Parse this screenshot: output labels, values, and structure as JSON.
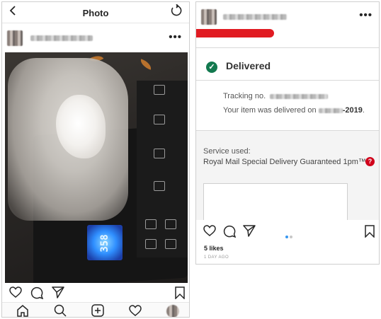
{
  "left_post": {
    "header": {
      "title": "Photo",
      "back_icon": "chevron-left-icon",
      "refresh_icon": "refresh-icon"
    },
    "user": {
      "avatar": "blurred-avatar",
      "username_blurred": true,
      "more_label": "•••"
    },
    "photo": {
      "scale_display": "358"
    },
    "actions": {
      "like_icon": "heart-icon",
      "comment_icon": "comment-icon",
      "share_icon": "send-icon",
      "save_icon": "bookmark-icon"
    },
    "bottom_nav": [
      {
        "icon": "home-icon"
      },
      {
        "icon": "search-icon"
      },
      {
        "icon": "add-post-icon"
      },
      {
        "icon": "activity-heart-icon"
      },
      {
        "icon": "profile-avatar"
      }
    ]
  },
  "right_post": {
    "user": {
      "username_blurred": true,
      "more_label": "•••"
    },
    "tracking": {
      "status": "Delivered",
      "tracking_label": "Tracking no.",
      "delivered_prefix": "Your item was delivered on",
      "delivered_year": "-2019",
      "delivered_suffix": "."
    },
    "service": {
      "label": "Service used:",
      "name": "Royal Mail Special Delivery Guaranteed 1pm™",
      "help_symbol": "?"
    },
    "carousel": {
      "active_index": 0,
      "count": 2,
      "active_color": "#3897f0",
      "inactive_color": "#c7c7c7"
    },
    "likes": "5 likes",
    "time_ago": "1 DAY AGO"
  },
  "colors": {
    "brand_red": "#e11b22",
    "delivered_green": "#13794f",
    "help_red": "#d0021b"
  }
}
